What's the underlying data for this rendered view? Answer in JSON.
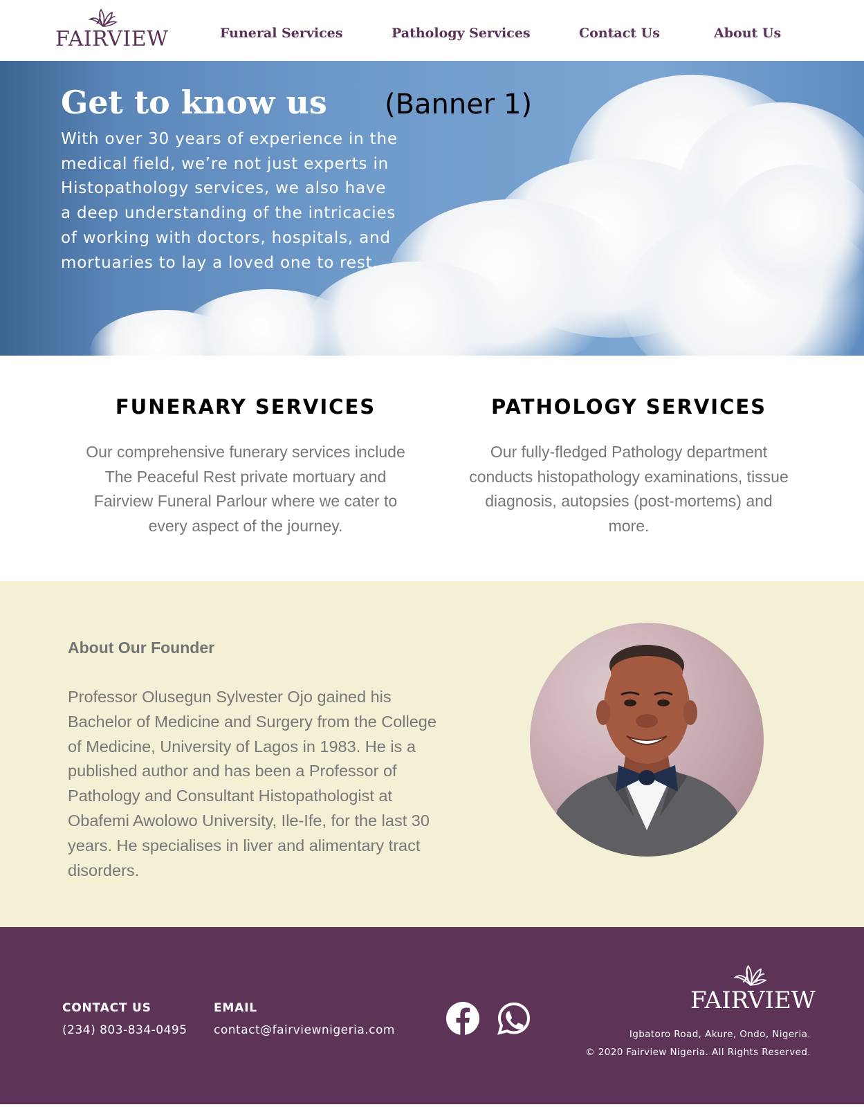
{
  "brand": {
    "name": "FAIRVIEW",
    "color": "#5c3358"
  },
  "nav": {
    "items": [
      {
        "label": "Funeral Services"
      },
      {
        "label": "Pathology Services"
      },
      {
        "label": "Contact Us"
      },
      {
        "label": "About Us"
      }
    ]
  },
  "banner": {
    "title": "Get to know us",
    "tag": "(Banner 1)",
    "text": "With over 30 years of experience in the medical field, we’re not just experts in Histopathology services, we also have a deep understanding of the intricacies of working with doctors, hospitals, and mortuaries to lay a loved one to rest.",
    "sky_color": "#6e9aca"
  },
  "services": [
    {
      "title": "FUNERARY SERVICES",
      "text": "Our comprehensive funerary services include The Peaceful Rest private mortuary and Fairview Funeral Parlour where we cater to every aspect of the journey."
    },
    {
      "title": "PATHOLOGY SERVICES",
      "text": "Our fully-fledged Pathology department conducts histopathology examinations, tissue diagnosis, autopsies (post-mortems) and more."
    }
  ],
  "founder": {
    "heading": "About Our Founder",
    "text": "Professor Olusegun Sylvester Ojo gained his Bachelor of Medicine and Surgery from the College of Medicine, University of Lagos in 1983. He is a published author and has been a Professor of Pathology and Consultant Histopathologist at Obafemi Awolowo University, Ile-Ife, for the last 30 years. He specialises in liver and alimentary tract disorders.",
    "background": "#f4f0d6"
  },
  "footer": {
    "contact_label": "CONTACT US",
    "phone": "(234) 803-834-0495",
    "email_label": "EMAIL",
    "email": "contact@fairviewnigeria.com",
    "social": [
      "facebook-icon",
      "whatsapp-icon"
    ],
    "logo_text": "FAIRVIEW",
    "address": "Igbatoro Road, Akure, Ondo, Nigeria.",
    "copyright": "© 2020 Fairview Nigeria. All Rights Reserved.",
    "background": "#5d3358"
  }
}
